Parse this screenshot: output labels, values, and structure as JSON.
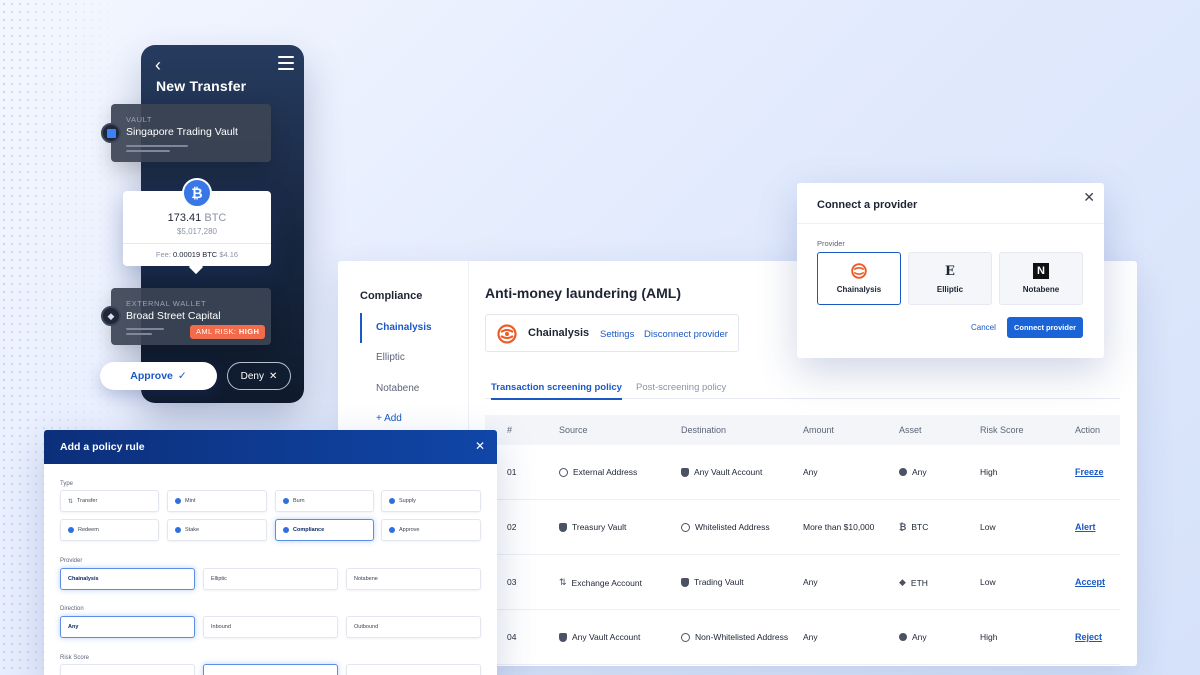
{
  "phone": {
    "title": "New Transfer",
    "vault": {
      "kicker": "VAULT",
      "name": "Singapore Trading Vault"
    },
    "amount": {
      "value": "173.41",
      "unit": "BTC",
      "usd": "$5,017,280",
      "fee_label": "Fee:",
      "fee_value": "0.00019 BTC",
      "fee_usd": "$4.16"
    },
    "wallet": {
      "kicker": "EXTERNAL WALLET",
      "name": "Broad Street Capital"
    },
    "risk": {
      "label": "AML RISK:",
      "level": "HIGH"
    },
    "approve_label": "Approve",
    "deny_label": "Deny",
    "colors": {
      "risk_badge": "#f26b4b",
      "accent": "#1a58c6"
    }
  },
  "compliance": {
    "sidebar_title": "Compliance",
    "sidebar_items": [
      "Chainalysis",
      "Elliptic",
      "Notabene"
    ],
    "add_label": "+ Add",
    "page_title": "Anti-money laundering (AML)",
    "provider": {
      "name": "Chainalysis",
      "settings_label": "Settings",
      "disconnect_label": "Disconnect provider"
    },
    "tabs": [
      "Transaction screening policy",
      "Post-screening policy"
    ],
    "table": {
      "headers": [
        "#",
        "Source",
        "Destination",
        "Amount",
        "Asset",
        "Risk Score",
        "Action"
      ],
      "rows": [
        {
          "num": "01",
          "source": "External Address",
          "source_icon": "globe-icon",
          "destination": "Any Vault Account",
          "destination_icon": "shield-icon",
          "amount": "Any",
          "asset": "Any",
          "asset_icon": "dot-icon",
          "risk": "High",
          "action": "Freeze"
        },
        {
          "num": "02",
          "source": "Treasury Vault",
          "source_icon": "shield-icon",
          "destination": "Whitelisted Address",
          "destination_icon": "globe-icon",
          "amount": "More than $10,000",
          "asset": "BTC",
          "asset_icon": "btc-icon",
          "risk": "Low",
          "action": "Alert"
        },
        {
          "num": "03",
          "source": "Exchange Account",
          "source_icon": "swap-icon",
          "destination": "Trading Vault",
          "destination_icon": "shield-icon",
          "amount": "Any",
          "asset": "ETH",
          "asset_icon": "eth-icon",
          "risk": "Low",
          "action": "Accept"
        },
        {
          "num": "04",
          "source": "Any Vault Account",
          "source_icon": "shield-icon",
          "destination": "Non-Whitelisted Address",
          "destination_icon": "globe-icon",
          "amount": "Any",
          "asset": "Any",
          "asset_icon": "dot-icon",
          "risk": "High",
          "action": "Reject"
        }
      ]
    }
  },
  "modal": {
    "title": "Connect a provider",
    "provider_label": "Provider",
    "providers": [
      "Chainalysis",
      "Elliptic",
      "Notabene"
    ],
    "selected": "Chainalysis",
    "cancel_label": "Cancel",
    "connect_label": "Connect provider"
  },
  "policy": {
    "title": "Add a policy rule",
    "type_label": "Type",
    "types": [
      "Transfer",
      "Mint",
      "Burn",
      "Supply",
      "Redeem",
      "Stake",
      "Compliance",
      "Approve"
    ],
    "type_selected": "Compliance",
    "provider_label": "Provider",
    "providers": [
      "Chainalysis",
      "Elliptic",
      "Notabene"
    ],
    "provider_selected": "Chainalysis",
    "direction_label": "Direction",
    "directions": [
      "Any",
      "Inbound",
      "Outbound"
    ],
    "direction_selected": "Any",
    "risk_label": "Risk Score"
  }
}
